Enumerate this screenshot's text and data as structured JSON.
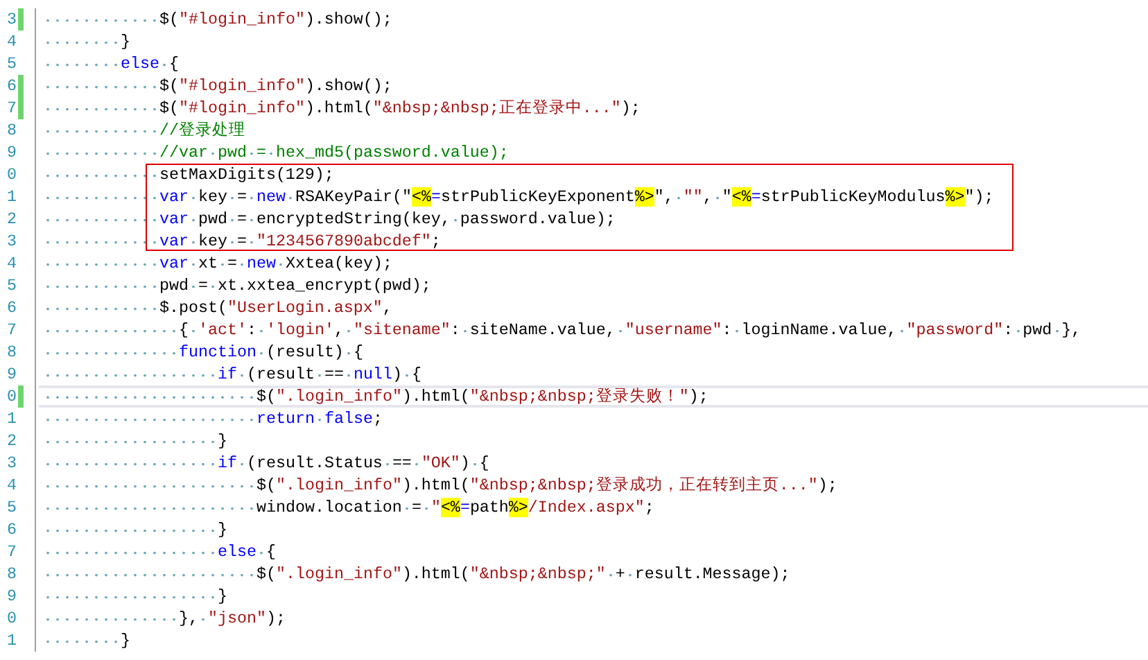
{
  "editor": {
    "lines": [
      {
        "number": "3",
        "modified": true,
        "current": false,
        "boxed": false,
        "tokens": [
          {
            "kind": "plain",
            "text": "            $("
          },
          {
            "kind": "string",
            "text": "\"#login_info\""
          },
          {
            "kind": "plain",
            "text": ").show();"
          }
        ]
      },
      {
        "number": "4",
        "modified": false,
        "current": false,
        "boxed": false,
        "tokens": [
          {
            "kind": "plain",
            "text": "        }"
          }
        ]
      },
      {
        "number": "5",
        "modified": false,
        "current": false,
        "boxed": false,
        "tokens": [
          {
            "kind": "keyword",
            "text": "        else"
          },
          {
            "kind": "plain",
            "text": " {"
          }
        ]
      },
      {
        "number": "6",
        "modified": true,
        "current": false,
        "boxed": false,
        "tokens": [
          {
            "kind": "plain",
            "text": "            $("
          },
          {
            "kind": "string",
            "text": "\"#login_info\""
          },
          {
            "kind": "plain",
            "text": ").show();"
          }
        ]
      },
      {
        "number": "7",
        "modified": true,
        "current": false,
        "boxed": false,
        "tokens": [
          {
            "kind": "plain",
            "text": "            $("
          },
          {
            "kind": "string",
            "text": "\"#login_info\""
          },
          {
            "kind": "plain",
            "text": ").html("
          },
          {
            "kind": "string",
            "text": "\"&nbsp;&nbsp;正在登录中...\""
          },
          {
            "kind": "plain",
            "text": ");"
          }
        ]
      },
      {
        "number": "8",
        "modified": false,
        "current": false,
        "boxed": false,
        "tokens": [
          {
            "kind": "comment",
            "text": "            //登录处理"
          }
        ]
      },
      {
        "number": "9",
        "modified": false,
        "current": false,
        "boxed": false,
        "tokens": [
          {
            "kind": "comment",
            "text": "            //var pwd = hex_md5(password.value);"
          }
        ]
      },
      {
        "number": "0",
        "modified": false,
        "current": false,
        "boxed": true,
        "tokens": [
          {
            "kind": "plain",
            "text": "            setMaxDigits(129);"
          }
        ]
      },
      {
        "number": "1",
        "modified": false,
        "current": false,
        "boxed": true,
        "tokens": [
          {
            "kind": "keyword",
            "text": "            var"
          },
          {
            "kind": "plain",
            "text": " key = "
          },
          {
            "kind": "keyword",
            "text": "new"
          },
          {
            "kind": "plain",
            "text": " RSAKeyPair(\""
          },
          {
            "kind": "tag",
            "text": "<%"
          },
          {
            "kind": "keyword",
            "text": "="
          },
          {
            "kind": "plain",
            "text": "strPublicKeyExponent"
          },
          {
            "kind": "tag",
            "text": "%>"
          },
          {
            "kind": "plain",
            "text": "\", "
          },
          {
            "kind": "string",
            "text": "\"\""
          },
          {
            "kind": "plain",
            "text": ", \""
          },
          {
            "kind": "tag",
            "text": "<%"
          },
          {
            "kind": "keyword",
            "text": "="
          },
          {
            "kind": "plain",
            "text": "strPublicKeyModulus"
          },
          {
            "kind": "tag",
            "text": "%>"
          },
          {
            "kind": "plain",
            "text": "\");"
          }
        ]
      },
      {
        "number": "2",
        "modified": false,
        "current": false,
        "boxed": true,
        "tokens": [
          {
            "kind": "keyword",
            "text": "            var"
          },
          {
            "kind": "plain",
            "text": " pwd = encryptedString(key, password.value);"
          }
        ]
      },
      {
        "number": "3",
        "modified": false,
        "current": false,
        "boxed": true,
        "tokens": [
          {
            "kind": "keyword",
            "text": "            var"
          },
          {
            "kind": "plain",
            "text": " key = "
          },
          {
            "kind": "string",
            "text": "\"1234567890abcdef\""
          },
          {
            "kind": "plain",
            "text": ";"
          }
        ]
      },
      {
        "number": "4",
        "modified": false,
        "current": false,
        "boxed": false,
        "tokens": [
          {
            "kind": "keyword",
            "text": "            var"
          },
          {
            "kind": "plain",
            "text": " xt = "
          },
          {
            "kind": "keyword",
            "text": "new"
          },
          {
            "kind": "plain",
            "text": " Xxtea(key);"
          }
        ]
      },
      {
        "number": "5",
        "modified": false,
        "current": false,
        "boxed": false,
        "tokens": [
          {
            "kind": "plain",
            "text": "            pwd = xt.xxtea_encrypt(pwd);"
          }
        ]
      },
      {
        "number": "6",
        "modified": false,
        "current": false,
        "boxed": false,
        "tokens": [
          {
            "kind": "plain",
            "text": "            $.post("
          },
          {
            "kind": "string",
            "text": "\"UserLogin.aspx\""
          },
          {
            "kind": "plain",
            "text": ","
          }
        ]
      },
      {
        "number": "7",
        "modified": false,
        "current": false,
        "boxed": false,
        "tokens": [
          {
            "kind": "plain",
            "text": "              { "
          },
          {
            "kind": "string",
            "text": "'act'"
          },
          {
            "kind": "plain",
            "text": ": "
          },
          {
            "kind": "string",
            "text": "'login'"
          },
          {
            "kind": "plain",
            "text": ", "
          },
          {
            "kind": "string",
            "text": "\"sitename\""
          },
          {
            "kind": "plain",
            "text": ": siteName.value, "
          },
          {
            "kind": "string",
            "text": "\"username\""
          },
          {
            "kind": "plain",
            "text": ": loginName.value, "
          },
          {
            "kind": "string",
            "text": "\"password\""
          },
          {
            "kind": "plain",
            "text": ": pwd },"
          }
        ]
      },
      {
        "number": "8",
        "modified": false,
        "current": false,
        "boxed": false,
        "tokens": [
          {
            "kind": "keyword",
            "text": "              function"
          },
          {
            "kind": "plain",
            "text": " (result) {"
          }
        ]
      },
      {
        "number": "9",
        "modified": false,
        "current": false,
        "boxed": false,
        "tokens": [
          {
            "kind": "keyword",
            "text": "                  if"
          },
          {
            "kind": "plain",
            "text": " (result == "
          },
          {
            "kind": "keyword",
            "text": "null"
          },
          {
            "kind": "plain",
            "text": ") {"
          }
        ]
      },
      {
        "number": "0",
        "modified": true,
        "current": true,
        "boxed": false,
        "tokens": [
          {
            "kind": "plain",
            "text": "                      $("
          },
          {
            "kind": "string",
            "text": "\".login_info\""
          },
          {
            "kind": "plain",
            "text": ").html("
          },
          {
            "kind": "string",
            "text": "\"&nbsp;&nbsp;登录失败！\""
          },
          {
            "kind": "plain",
            "text": ");"
          }
        ]
      },
      {
        "number": "1",
        "modified": false,
        "current": false,
        "boxed": false,
        "tokens": [
          {
            "kind": "keyword",
            "text": "                      return false"
          },
          {
            "kind": "plain",
            "text": ";"
          }
        ]
      },
      {
        "number": "2",
        "modified": false,
        "current": false,
        "boxed": false,
        "tokens": [
          {
            "kind": "plain",
            "text": "                  }"
          }
        ]
      },
      {
        "number": "3",
        "modified": false,
        "current": false,
        "boxed": false,
        "tokens": [
          {
            "kind": "keyword",
            "text": "                  if"
          },
          {
            "kind": "plain",
            "text": " (result.Status == "
          },
          {
            "kind": "string",
            "text": "\"OK\""
          },
          {
            "kind": "plain",
            "text": ") {"
          }
        ]
      },
      {
        "number": "4",
        "modified": false,
        "current": false,
        "boxed": false,
        "tokens": [
          {
            "kind": "plain",
            "text": "                      $("
          },
          {
            "kind": "string",
            "text": "\".login_info\""
          },
          {
            "kind": "plain",
            "text": ").html("
          },
          {
            "kind": "string",
            "text": "\"&nbsp;&nbsp;登录成功，正在转到主页...\""
          },
          {
            "kind": "plain",
            "text": ");"
          }
        ]
      },
      {
        "number": "5",
        "modified": false,
        "current": false,
        "boxed": false,
        "tokens": [
          {
            "kind": "plain",
            "text": "                      window.location = "
          },
          {
            "kind": "string",
            "text": "\""
          },
          {
            "kind": "tag",
            "text": "<%"
          },
          {
            "kind": "keyword",
            "text": "="
          },
          {
            "kind": "plain",
            "text": "path"
          },
          {
            "kind": "tag",
            "text": "%>"
          },
          {
            "kind": "string",
            "text": "/Index.aspx\""
          },
          {
            "kind": "plain",
            "text": ";"
          }
        ]
      },
      {
        "number": "6",
        "modified": false,
        "current": false,
        "boxed": false,
        "tokens": [
          {
            "kind": "plain",
            "text": "                  }"
          }
        ]
      },
      {
        "number": "7",
        "modified": false,
        "current": false,
        "boxed": false,
        "tokens": [
          {
            "kind": "keyword",
            "text": "                  else"
          },
          {
            "kind": "plain",
            "text": " {"
          }
        ]
      },
      {
        "number": "8",
        "modified": false,
        "current": false,
        "boxed": false,
        "tokens": [
          {
            "kind": "plain",
            "text": "                      $("
          },
          {
            "kind": "string",
            "text": "\".login_info\""
          },
          {
            "kind": "plain",
            "text": ").html("
          },
          {
            "kind": "string",
            "text": "\"&nbsp;&nbsp;\""
          },
          {
            "kind": "plain",
            "text": " + result.Message);"
          }
        ]
      },
      {
        "number": "9",
        "modified": false,
        "current": false,
        "boxed": false,
        "tokens": [
          {
            "kind": "plain",
            "text": "                  }"
          }
        ]
      },
      {
        "number": "0",
        "modified": false,
        "current": false,
        "boxed": false,
        "tokens": [
          {
            "kind": "plain",
            "text": "              }, "
          },
          {
            "kind": "string",
            "text": "\"json\""
          },
          {
            "kind": "plain",
            "text": ");"
          }
        ]
      },
      {
        "number": "1",
        "modified": false,
        "current": false,
        "boxed": false,
        "tokens": [
          {
            "kind": "plain",
            "text": "        }"
          }
        ]
      }
    ]
  }
}
